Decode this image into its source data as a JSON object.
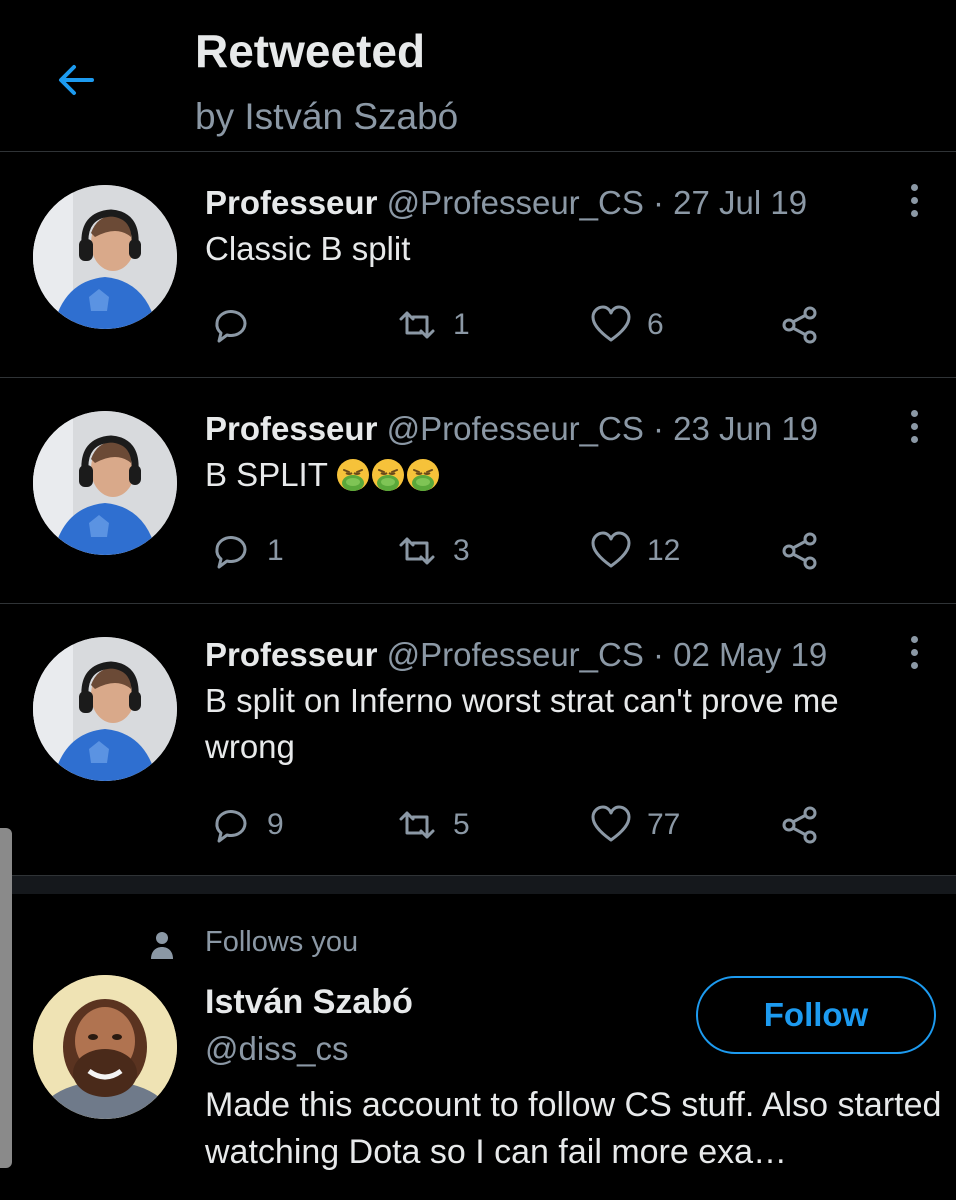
{
  "header": {
    "title": "Retweeted",
    "subtitle": "by István Szabó"
  },
  "tweets": [
    {
      "name": "Professeur",
      "meta": "@Professeur_CS · 27 Jul 19",
      "text": "Classic B split",
      "emoji_count": 0,
      "reply_count": "",
      "retweet_count": "1",
      "like_count": "6"
    },
    {
      "name": "Professeur",
      "meta": "@Professeur_CS · 23 Jun 19",
      "text": "B SPLIT",
      "emoji": "nauseated-face",
      "emoji_count": 3,
      "reply_count": "1",
      "retweet_count": "3",
      "like_count": "12"
    },
    {
      "name": "Professeur",
      "meta": "@Professeur_CS · 02 May 19",
      "text": "B split on Inferno worst strat can't prove me wrong",
      "emoji_count": 0,
      "reply_count": "9",
      "retweet_count": "5",
      "like_count": "77"
    }
  ],
  "user_card": {
    "follows_label": "Follows you",
    "name": "István Szabó",
    "handle": "@diss_cs",
    "follow_label": "Follow",
    "bio": "Made this account to follow CS stuff. Also started watching Dota so I can fail more exa…"
  },
  "colors": {
    "background": "#000000",
    "accent": "#1d9bf0",
    "muted": "#8b98a5",
    "text": "#e7e9ea",
    "border": "#2f3336"
  },
  "icons": {
    "back": "arrow-left-icon",
    "more": "more-vertical-icon",
    "reply": "reply-icon",
    "retweet": "retweet-icon",
    "like": "heart-icon",
    "share": "share-icon",
    "person": "person-icon"
  }
}
